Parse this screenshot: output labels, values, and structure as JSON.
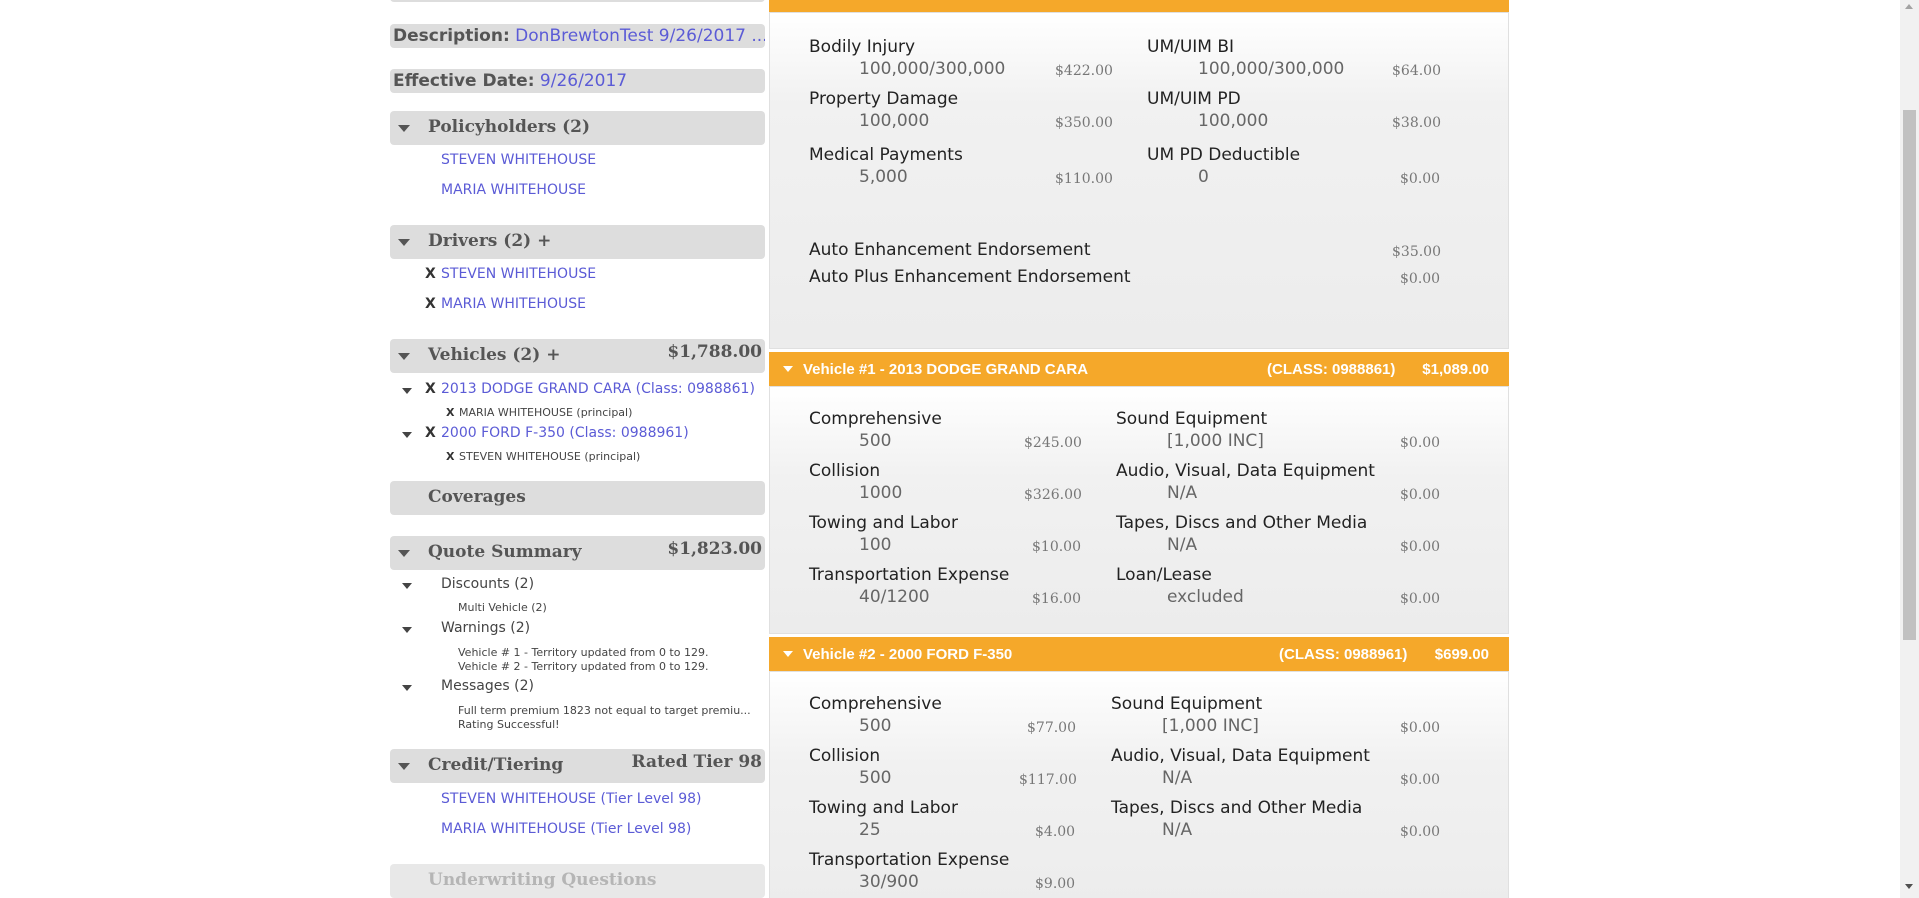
{
  "sidebar": {
    "description": {
      "label": "Description:",
      "value": "DonBrewtonTest 9/26/2017 ..."
    },
    "effective_date": {
      "label": "Effective Date:",
      "value": "9/26/2017"
    },
    "policyholders": {
      "title": "Policyholders (2)",
      "items": [
        "STEVEN WHITEHOUSE",
        "MARIA WHITEHOUSE"
      ]
    },
    "drivers": {
      "title": "Drivers (2) +",
      "remove_glyph": "X",
      "items": [
        "STEVEN WHITEHOUSE",
        "MARIA WHITEHOUSE"
      ]
    },
    "vehicles": {
      "title": "Vehicles (2) +",
      "amount": "$1,788.00",
      "items": [
        {
          "name": "2013 DODGE GRAND CARA (Class: 0988861)",
          "driver": "MARIA WHITEHOUSE (principal)"
        },
        {
          "name": "2000 FORD F-350 (Class: 0988961)",
          "driver": "STEVEN WHITEHOUSE (principal)"
        }
      ]
    },
    "coverages": {
      "title": "Coverages"
    },
    "quote_summary": {
      "title": "Quote Summary",
      "amount": "$1,823.00",
      "discounts": {
        "label": "Discounts (2)",
        "items": [
          "Multi Vehicle (2)"
        ]
      },
      "warnings": {
        "label": "Warnings (2)",
        "items": [
          "Vehicle # 1 - Territory updated from 0 to 129.",
          "Vehicle # 2 - Territory updated from 0 to 129."
        ]
      },
      "messages": {
        "label": "Messages (2)",
        "items": [
          "Full term premium 1823 not equal to target premiu...",
          "Rating Successful!"
        ]
      }
    },
    "credit_tiering": {
      "title": "Credit/Tiering",
      "amount": "Rated Tier 98",
      "items": [
        "STEVEN WHITEHOUSE (Tier Level 98)",
        "MARIA WHITEHOUSE (Tier Level 98)"
      ]
    },
    "underwriting": {
      "title": "Underwriting Questions"
    }
  },
  "policy_coverages": {
    "left": [
      {
        "name": "Bodily Injury",
        "limit": "100,000/300,000",
        "premium": "$422.00"
      },
      {
        "name": "Property Damage",
        "limit": "100,000",
        "premium": "$350.00"
      },
      {
        "name": "Medical Payments",
        "limit": "5,000",
        "premium": "$110.00"
      }
    ],
    "right": [
      {
        "name": "UM/UIM BI",
        "limit": "100,000/300,000",
        "premium": "$64.00"
      },
      {
        "name": "UM/UIM PD",
        "limit": "100,000",
        "premium": "$38.00"
      },
      {
        "name": "UM PD Deductible",
        "limit": "0",
        "premium": "$0.00"
      }
    ],
    "endorsements": [
      {
        "name": "Auto Enhancement Endorsement",
        "premium": "$35.00"
      },
      {
        "name": "Auto Plus Enhancement Endorsement",
        "premium": "$0.00"
      }
    ]
  },
  "vehicle1": {
    "title": "Vehicle #1 - 2013 DODGE GRAND CARA",
    "class": "(CLASS: 0988861)",
    "price": "$1,089.00",
    "left": [
      {
        "name": "Comprehensive",
        "limit": "500",
        "premium": "$245.00"
      },
      {
        "name": "Collision",
        "limit": "1000",
        "premium": "$326.00"
      },
      {
        "name": "Towing and Labor",
        "limit": "100",
        "premium": "$10.00"
      },
      {
        "name": "Transportation Expense",
        "limit": "40/1200",
        "premium": "$16.00"
      }
    ],
    "right": [
      {
        "name": "Sound Equipment",
        "limit": "[1,000 INC]",
        "premium": "$0.00"
      },
      {
        "name": "Audio, Visual, Data Equipment",
        "limit": "N/A",
        "premium": "$0.00"
      },
      {
        "name": "Tapes, Discs and Other Media",
        "limit": "N/A",
        "premium": "$0.00"
      },
      {
        "name": "Loan/Lease",
        "limit": "excluded",
        "premium": "$0.00"
      }
    ]
  },
  "vehicle2": {
    "title": "Vehicle #2 - 2000 FORD F-350",
    "class": "(CLASS: 0988961)",
    "price": "$699.00",
    "left": [
      {
        "name": "Comprehensive",
        "limit": "500",
        "premium": "$77.00"
      },
      {
        "name": "Collision",
        "limit": "500",
        "premium": "$117.00"
      },
      {
        "name": "Towing and Labor",
        "limit": "25",
        "premium": "$4.00"
      },
      {
        "name": "Transportation Expense",
        "limit": "30/900",
        "premium": "$9.00"
      }
    ],
    "right": [
      {
        "name": "Sound Equipment",
        "limit": "[1,000 INC]",
        "premium": "$0.00"
      },
      {
        "name": "Audio, Visual, Data Equipment",
        "limit": "N/A",
        "premium": "$0.00"
      },
      {
        "name": "Tapes, Discs and Other Media",
        "limit": "N/A",
        "premium": "$0.00"
      }
    ]
  }
}
